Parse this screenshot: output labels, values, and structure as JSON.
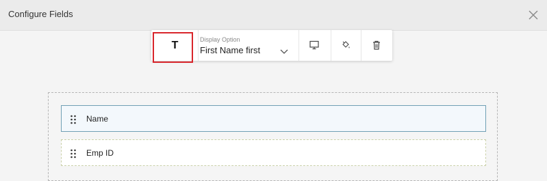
{
  "header": {
    "title": "Configure Fields",
    "close_icon": "close-icon"
  },
  "toolbar": {
    "text_type_label": "T",
    "display_option": {
      "label": "Display Option",
      "value": "First Name first"
    },
    "icons": [
      "monitor-icon",
      "paint-bucket-icon",
      "trash-icon"
    ]
  },
  "highlight_color": "#d8242a",
  "fields": [
    {
      "label": "Name",
      "state": "selected"
    },
    {
      "label": "Emp ID",
      "state": "normal"
    }
  ]
}
